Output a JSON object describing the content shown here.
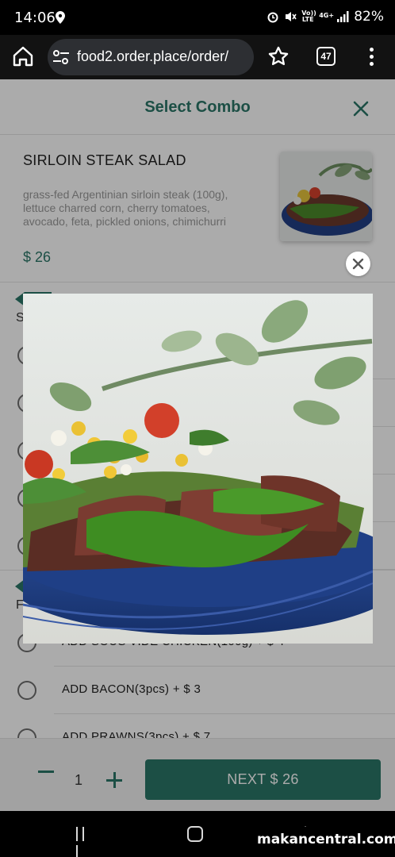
{
  "status_bar": {
    "time": "14:06",
    "battery": "82%",
    "network_label_1": "Vo))",
    "network_label_2": "LTE",
    "network_type": "4G+"
  },
  "browser": {
    "url": "food2.order.place/order/",
    "tab_count": "47"
  },
  "modal": {
    "title": "Select Combo",
    "product": {
      "name": "SIRLOIN STEAK SALAD",
      "description": "grass-fed Argentinian sirloin steak (100g), lettuce charred corn, cherry tomatoes, avocado, feta, pickled onions, chimichurri",
      "price": "$ 26"
    },
    "sections": [
      {
        "label": "S"
      },
      {
        "label": "F"
      }
    ],
    "options": [
      {
        "label": "ADD SOUS VIDE CHICKEN(100g)  + $ 4"
      },
      {
        "label": "ADD BACON(3pcs)  + $ 3"
      },
      {
        "label": "ADD PRAWNS(3pcs)  + $ 7"
      }
    ]
  },
  "footer": {
    "quantity": "1",
    "next_label": "NEXT  $ 26"
  },
  "watermark": "makancentral.com",
  "colors": {
    "accent": "#2b7668",
    "plate": "#1f3f86",
    "chimichurri": "#3e8d22"
  }
}
